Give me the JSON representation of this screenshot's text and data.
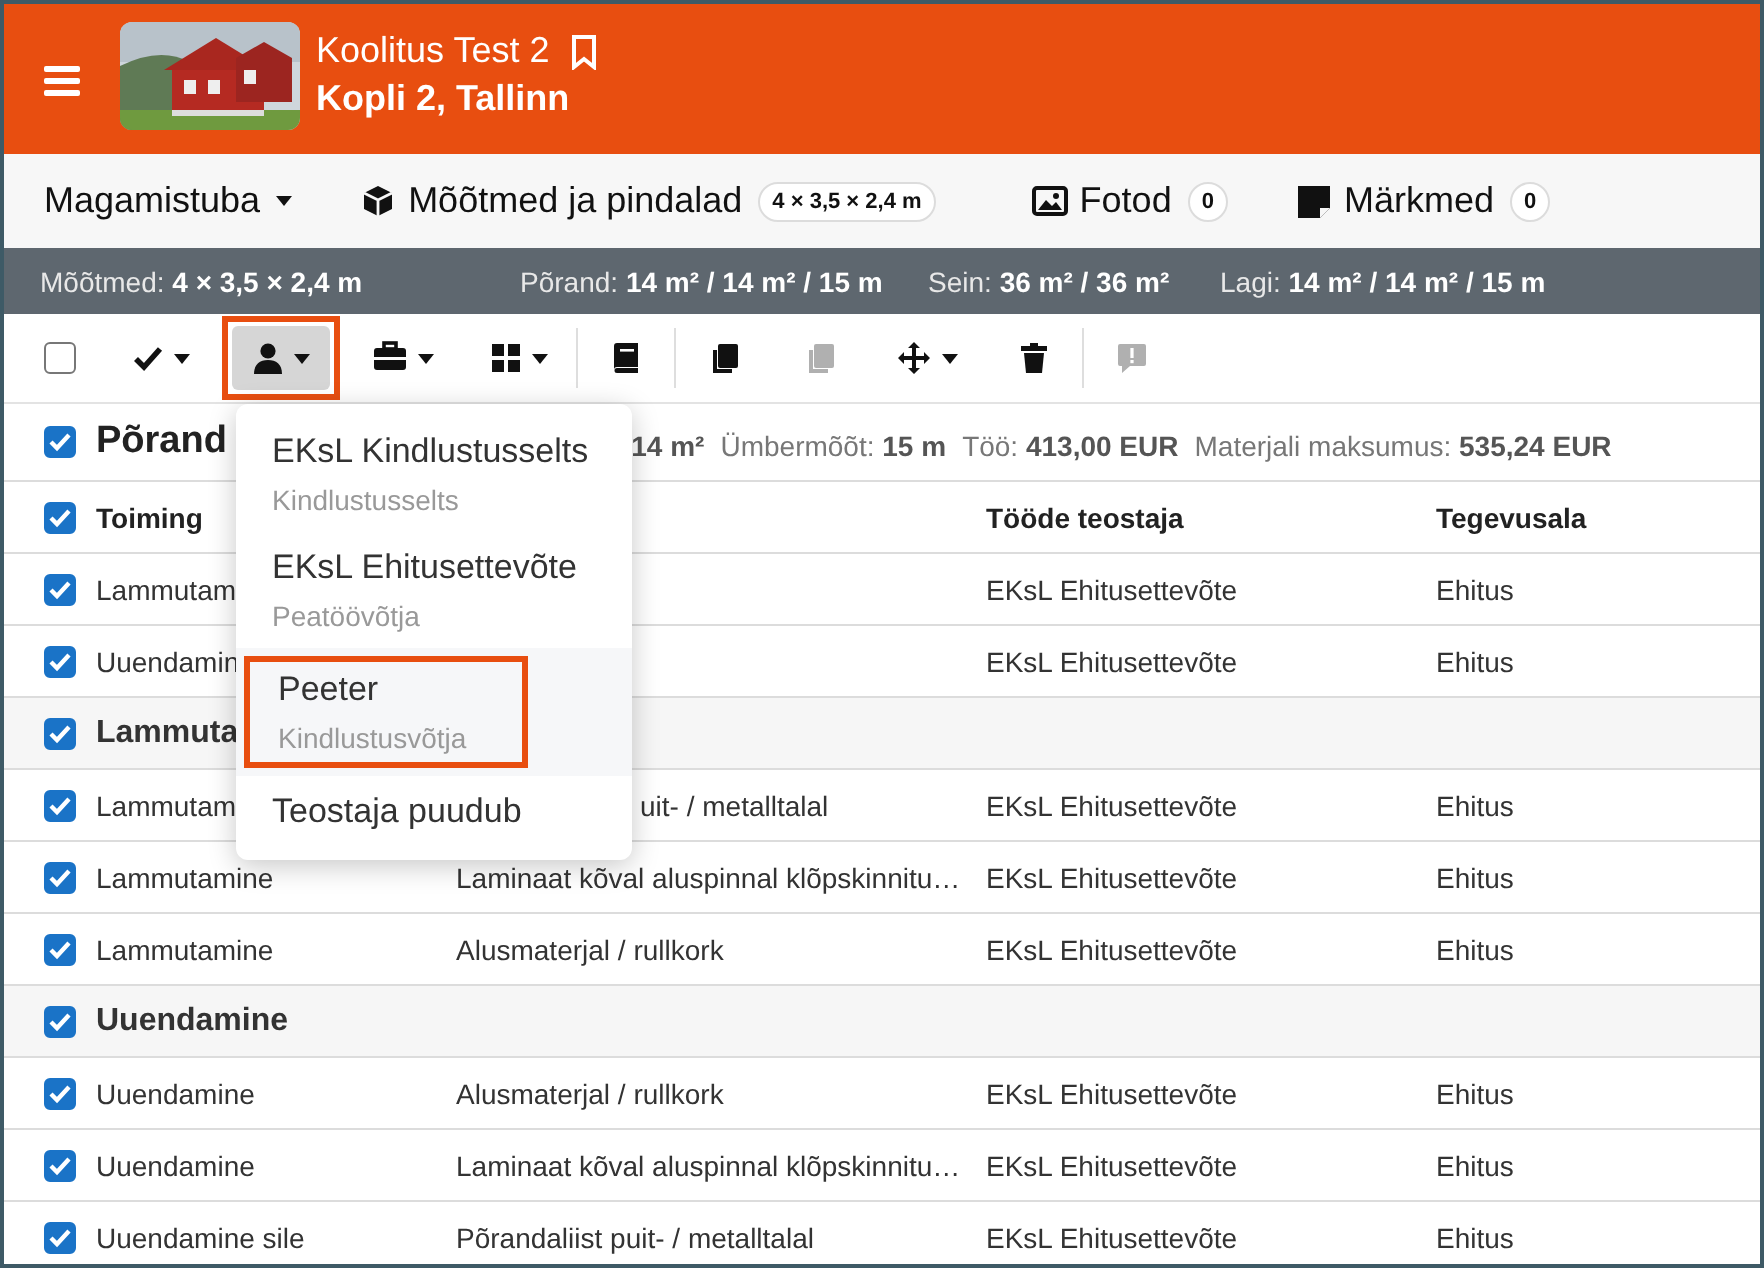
{
  "header": {
    "title": "Koolitus Test 2",
    "subtitle": "Kopli 2, Tallinn"
  },
  "nav": {
    "room": "Magamistuba",
    "tabs": [
      {
        "label": "Mõõtmed ja pindalad",
        "badge": "4 × 3,5 × 2,4 m"
      },
      {
        "label": "Fotod",
        "badge": "0"
      },
      {
        "label": "Märkmed",
        "badge": "0"
      }
    ]
  },
  "summary": [
    {
      "label": "Mõõtmed:",
      "value": "4 × 3,5 × 2,4 m"
    },
    {
      "label": "Põrand:",
      "value": "14 m² / 14 m² / 15 m"
    },
    {
      "label": "Sein:",
      "value": "36 m² / 36 m²"
    },
    {
      "label": "Lagi:",
      "value": "14 m² / 14 m² / 15 m"
    }
  ],
  "toolbar": [
    {
      "kind": "checkbox",
      "checked": false
    },
    {
      "kind": "button",
      "caret": true,
      "disabled": false,
      "pressed": false,
      "highlighted": false
    },
    {
      "kind": "button",
      "caret": true,
      "disabled": false,
      "pressed": true,
      "highlighted": true
    },
    {
      "kind": "button",
      "caret": true,
      "disabled": false,
      "pressed": false,
      "highlighted": false
    },
    {
      "kind": "button",
      "caret": true,
      "disabled": false,
      "pressed": false,
      "highlighted": false
    },
    {
      "kind": "divider"
    },
    {
      "kind": "button",
      "caret": false,
      "disabled": false,
      "pressed": false,
      "highlighted": false
    },
    {
      "kind": "divider"
    },
    {
      "kind": "button",
      "caret": false,
      "disabled": false,
      "pressed": false,
      "highlighted": false
    },
    {
      "kind": "button",
      "caret": false,
      "disabled": true,
      "pressed": false,
      "highlighted": false
    },
    {
      "kind": "button",
      "caret": true,
      "disabled": false,
      "pressed": false,
      "highlighted": false
    },
    {
      "kind": "button",
      "caret": false,
      "disabled": false,
      "pressed": false,
      "highlighted": false
    },
    {
      "kind": "divider"
    },
    {
      "kind": "button",
      "caret": false,
      "disabled": true,
      "pressed": false,
      "highlighted": false
    }
  ],
  "section": {
    "checked": true,
    "title": "Põrand",
    "stats": [
      {
        "value": "14 m²"
      },
      {
        "label": "Ümbermõõt:",
        "value": "15 m"
      },
      {
        "label": "Töö:",
        "value": "413,00 EUR"
      },
      {
        "label": "Materjali maksumus:",
        "value": "535,24 EUR"
      }
    ]
  },
  "table": {
    "header": {
      "checked": true,
      "cells": [
        "Toiming",
        null,
        "Tööde teostaja",
        "Tegevusala"
      ]
    },
    "rows": [
      {
        "kind": "item",
        "checked": true,
        "cells": [
          "Lammutam",
          null,
          "EKsL Ehitusettevõte",
          "Ehitus"
        ]
      },
      {
        "kind": "item",
        "checked": true,
        "cells": [
          "Uuendamin",
          null,
          "EKsL Ehitusettevõte",
          "Ehitus"
        ]
      },
      {
        "kind": "group",
        "checked": true,
        "cells": [
          "Lammuta"
        ]
      },
      {
        "kind": "item",
        "checked": true,
        "cells": [
          "Lammutam",
          {
            "text": "uit- / metalltalal",
            "under_menu": true
          },
          "EKsL Ehitusettevõte",
          "Ehitus"
        ]
      },
      {
        "kind": "item",
        "checked": true,
        "cells": [
          "Lammutamine",
          "Laminaat kõval aluspinnal klõpskinnitu…",
          "EKsL Ehitusettevõte",
          "Ehitus"
        ]
      },
      {
        "kind": "item",
        "checked": true,
        "cells": [
          "Lammutamine",
          "Alusmaterjal / rullkork",
          "EKsL Ehitusettevõte",
          "Ehitus"
        ]
      },
      {
        "kind": "group",
        "checked": true,
        "cells": [
          "Uuendamine"
        ]
      },
      {
        "kind": "item",
        "checked": true,
        "cells": [
          "Uuendamine",
          "Alusmaterjal / rullkork",
          "EKsL Ehitusettevõte",
          "Ehitus"
        ]
      },
      {
        "kind": "item",
        "checked": true,
        "cells": [
          "Uuendamine",
          "Laminaat kõval aluspinnal klõpskinnitu…",
          "EKsL Ehitusettevõte",
          "Ehitus"
        ]
      },
      {
        "kind": "item",
        "checked": true,
        "cells": [
          "Uuendamine sile",
          "Põrandaliist puit- / metalltalal",
          "EKsL Ehitusettevõte",
          "Ehitus"
        ]
      }
    ]
  },
  "menu": [
    {
      "title": "EKsL Kindlustusselts",
      "subtitle": "Kindlustusselts",
      "hovered": false,
      "highlighted": false
    },
    {
      "title": "EKsL Ehitusettevõte",
      "subtitle": "Peatöövõtja",
      "hovered": false,
      "highlighted": false
    },
    {
      "title": "Peeter",
      "subtitle": "Kindlustusvõtja",
      "hovered": true,
      "highlighted": true
    },
    {
      "title": "Teostaja puudub",
      "hovered": false,
      "highlighted": false
    }
  ]
}
